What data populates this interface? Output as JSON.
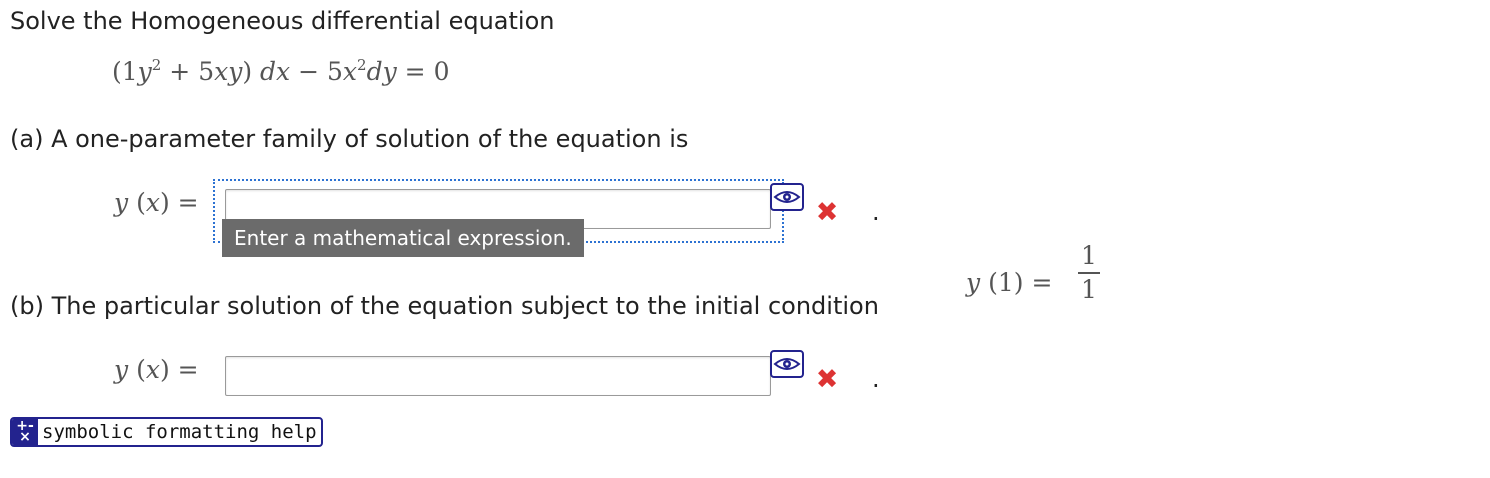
{
  "problem": {
    "intro": "Solve the Homogeneous differential equation",
    "equation": {
      "coef1": "1",
      "var_y": "y",
      "exp": "2",
      "plus": "+",
      "coef2": "5",
      "xy": "xy",
      "dx": "dx",
      "minus": "−",
      "coef3": "5",
      "var_x": "x",
      "dy": "dy",
      "eq": "=",
      "zero": "0"
    }
  },
  "part_a": {
    "prompt": "(a) A one-parameter family of solution of the equation is",
    "lhs": {
      "func": "y",
      "lparen": "(",
      "arg": "x",
      "rparen": ")",
      "eq": "="
    },
    "input_value": "",
    "tooltip": "Enter a mathematical expression.",
    "status_icon": "wrong-x-icon",
    "status_glyph": "✖",
    "trailing": "."
  },
  "part_b": {
    "prompt": "(b) The particular solution of the equation subject to the initial condition",
    "condition": {
      "func": "y",
      "lparen": "(",
      "arg": "1",
      "rparen": ")",
      "eq": "=",
      "numerator": "1",
      "denominator": "1"
    },
    "lhs": {
      "func": "y",
      "lparen": "(",
      "arg": "x",
      "rparen": ")",
      "eq": "="
    },
    "input_value": "",
    "status_icon": "wrong-x-icon",
    "status_glyph": "✖",
    "trailing": "."
  },
  "help": {
    "icon_glyph": "+-×",
    "label": "symbolic formatting help"
  },
  "colors": {
    "focus": "#2d72d2",
    "wrong": "#dd3333",
    "icon_border": "#23238e",
    "tooltip_bg": "#6b6b6b"
  }
}
